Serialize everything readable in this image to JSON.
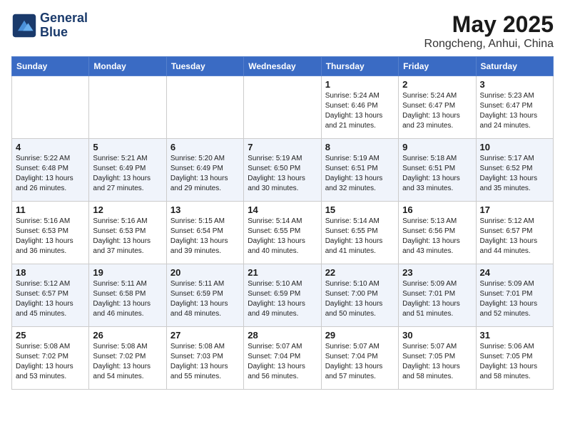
{
  "header": {
    "logo_line1": "General",
    "logo_line2": "Blue",
    "month_year": "May 2025",
    "location": "Rongcheng, Anhui, China"
  },
  "weekdays": [
    "Sunday",
    "Monday",
    "Tuesday",
    "Wednesday",
    "Thursday",
    "Friday",
    "Saturday"
  ],
  "weeks": [
    [
      {
        "day": "",
        "info": ""
      },
      {
        "day": "",
        "info": ""
      },
      {
        "day": "",
        "info": ""
      },
      {
        "day": "",
        "info": ""
      },
      {
        "day": "1",
        "info": "Sunrise: 5:24 AM\nSunset: 6:46 PM\nDaylight: 13 hours\nand 21 minutes."
      },
      {
        "day": "2",
        "info": "Sunrise: 5:24 AM\nSunset: 6:47 PM\nDaylight: 13 hours\nand 23 minutes."
      },
      {
        "day": "3",
        "info": "Sunrise: 5:23 AM\nSunset: 6:47 PM\nDaylight: 13 hours\nand 24 minutes."
      }
    ],
    [
      {
        "day": "4",
        "info": "Sunrise: 5:22 AM\nSunset: 6:48 PM\nDaylight: 13 hours\nand 26 minutes."
      },
      {
        "day": "5",
        "info": "Sunrise: 5:21 AM\nSunset: 6:49 PM\nDaylight: 13 hours\nand 27 minutes."
      },
      {
        "day": "6",
        "info": "Sunrise: 5:20 AM\nSunset: 6:49 PM\nDaylight: 13 hours\nand 29 minutes."
      },
      {
        "day": "7",
        "info": "Sunrise: 5:19 AM\nSunset: 6:50 PM\nDaylight: 13 hours\nand 30 minutes."
      },
      {
        "day": "8",
        "info": "Sunrise: 5:19 AM\nSunset: 6:51 PM\nDaylight: 13 hours\nand 32 minutes."
      },
      {
        "day": "9",
        "info": "Sunrise: 5:18 AM\nSunset: 6:51 PM\nDaylight: 13 hours\nand 33 minutes."
      },
      {
        "day": "10",
        "info": "Sunrise: 5:17 AM\nSunset: 6:52 PM\nDaylight: 13 hours\nand 35 minutes."
      }
    ],
    [
      {
        "day": "11",
        "info": "Sunrise: 5:16 AM\nSunset: 6:53 PM\nDaylight: 13 hours\nand 36 minutes."
      },
      {
        "day": "12",
        "info": "Sunrise: 5:16 AM\nSunset: 6:53 PM\nDaylight: 13 hours\nand 37 minutes."
      },
      {
        "day": "13",
        "info": "Sunrise: 5:15 AM\nSunset: 6:54 PM\nDaylight: 13 hours\nand 39 minutes."
      },
      {
        "day": "14",
        "info": "Sunrise: 5:14 AM\nSunset: 6:55 PM\nDaylight: 13 hours\nand 40 minutes."
      },
      {
        "day": "15",
        "info": "Sunrise: 5:14 AM\nSunset: 6:55 PM\nDaylight: 13 hours\nand 41 minutes."
      },
      {
        "day": "16",
        "info": "Sunrise: 5:13 AM\nSunset: 6:56 PM\nDaylight: 13 hours\nand 43 minutes."
      },
      {
        "day": "17",
        "info": "Sunrise: 5:12 AM\nSunset: 6:57 PM\nDaylight: 13 hours\nand 44 minutes."
      }
    ],
    [
      {
        "day": "18",
        "info": "Sunrise: 5:12 AM\nSunset: 6:57 PM\nDaylight: 13 hours\nand 45 minutes."
      },
      {
        "day": "19",
        "info": "Sunrise: 5:11 AM\nSunset: 6:58 PM\nDaylight: 13 hours\nand 46 minutes."
      },
      {
        "day": "20",
        "info": "Sunrise: 5:11 AM\nSunset: 6:59 PM\nDaylight: 13 hours\nand 48 minutes."
      },
      {
        "day": "21",
        "info": "Sunrise: 5:10 AM\nSunset: 6:59 PM\nDaylight: 13 hours\nand 49 minutes."
      },
      {
        "day": "22",
        "info": "Sunrise: 5:10 AM\nSunset: 7:00 PM\nDaylight: 13 hours\nand 50 minutes."
      },
      {
        "day": "23",
        "info": "Sunrise: 5:09 AM\nSunset: 7:01 PM\nDaylight: 13 hours\nand 51 minutes."
      },
      {
        "day": "24",
        "info": "Sunrise: 5:09 AM\nSunset: 7:01 PM\nDaylight: 13 hours\nand 52 minutes."
      }
    ],
    [
      {
        "day": "25",
        "info": "Sunrise: 5:08 AM\nSunset: 7:02 PM\nDaylight: 13 hours\nand 53 minutes."
      },
      {
        "day": "26",
        "info": "Sunrise: 5:08 AM\nSunset: 7:02 PM\nDaylight: 13 hours\nand 54 minutes."
      },
      {
        "day": "27",
        "info": "Sunrise: 5:08 AM\nSunset: 7:03 PM\nDaylight: 13 hours\nand 55 minutes."
      },
      {
        "day": "28",
        "info": "Sunrise: 5:07 AM\nSunset: 7:04 PM\nDaylight: 13 hours\nand 56 minutes."
      },
      {
        "day": "29",
        "info": "Sunrise: 5:07 AM\nSunset: 7:04 PM\nDaylight: 13 hours\nand 57 minutes."
      },
      {
        "day": "30",
        "info": "Sunrise: 5:07 AM\nSunset: 7:05 PM\nDaylight: 13 hours\nand 58 minutes."
      },
      {
        "day": "31",
        "info": "Sunrise: 5:06 AM\nSunset: 7:05 PM\nDaylight: 13 hours\nand 58 minutes."
      }
    ]
  ]
}
